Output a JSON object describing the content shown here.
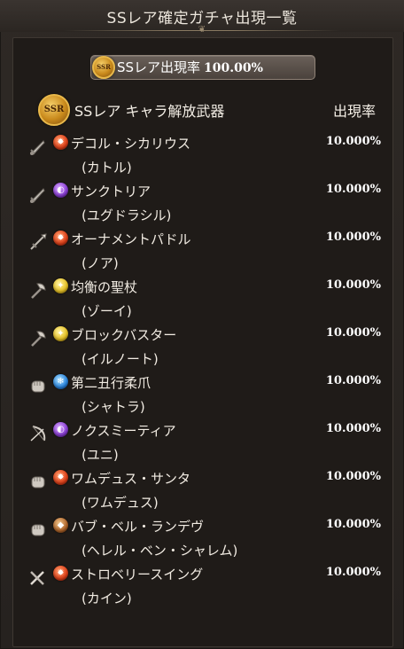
{
  "header": {
    "title": "SSレア確定ガチャ出現一覧"
  },
  "summary": {
    "rate_label": "SSレア出現率",
    "rate_value": "100.00%",
    "badge_text": "SSR"
  },
  "section": {
    "title": "SSレア キャラ解放武器",
    "rate_header": "出現率",
    "badge_text": "SSR"
  },
  "items": [
    {
      "name": "デコル・シカリウス",
      "character": "(カトル)",
      "rate": "10.000%",
      "element": "fire",
      "weapon": "dagger"
    },
    {
      "name": "サンクトリア",
      "character": "(ユグドラシル)",
      "rate": "10.000%",
      "element": "dark",
      "weapon": "dagger"
    },
    {
      "name": "オーナメントパドル",
      "character": "(ノア)",
      "rate": "10.000%",
      "element": "fire",
      "weapon": "spear"
    },
    {
      "name": "均衡の聖杖",
      "character": "(ゾーイ)",
      "rate": "10.000%",
      "element": "light",
      "weapon": "axe"
    },
    {
      "name": "ブロックバスター",
      "character": "(イルノート)",
      "rate": "10.000%",
      "element": "light",
      "weapon": "axe"
    },
    {
      "name": "第二丑行柔爪",
      "character": "(シャトラ)",
      "rate": "10.000%",
      "element": "water",
      "weapon": "fist"
    },
    {
      "name": "ノクスミーティア",
      "character": "(ユニ)",
      "rate": "10.000%",
      "element": "dark",
      "weapon": "bow"
    },
    {
      "name": "ワムデュス・サンタ",
      "character": "(ワムデュス)",
      "rate": "10.000%",
      "element": "fire",
      "weapon": "fist"
    },
    {
      "name": "バブ・ベル・ランデヴ",
      "character": "(ヘレル・ベン・シャレム)",
      "rate": "10.000%",
      "element": "earth",
      "weapon": "fist"
    },
    {
      "name": "ストロベリースイング",
      "character": "(カイン)",
      "rate": "10.000%",
      "element": "fire",
      "weapon": "sword"
    }
  ]
}
